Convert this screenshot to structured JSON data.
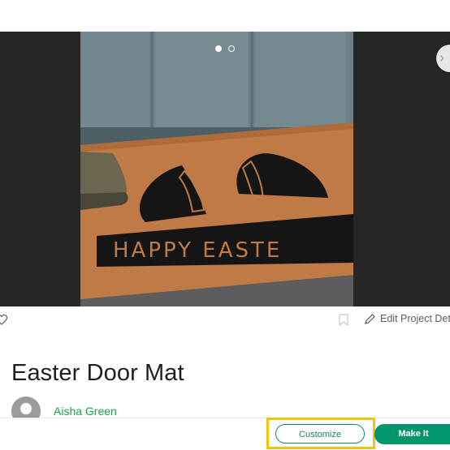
{
  "carousel": {
    "slide_count": 2,
    "active_index": 0,
    "photo_text": "HAPPY EASTE"
  },
  "actions": {
    "edit_label": "Edit Project Det"
  },
  "project": {
    "title": "Easter Door Mat",
    "author": "Aisha Green"
  },
  "footer": {
    "customize_label": "Customize",
    "make_label": "Make It"
  },
  "colors": {
    "brand_green": "#16a34a",
    "button_green": "#00956b",
    "highlight_yellow": "#f4c20d"
  }
}
